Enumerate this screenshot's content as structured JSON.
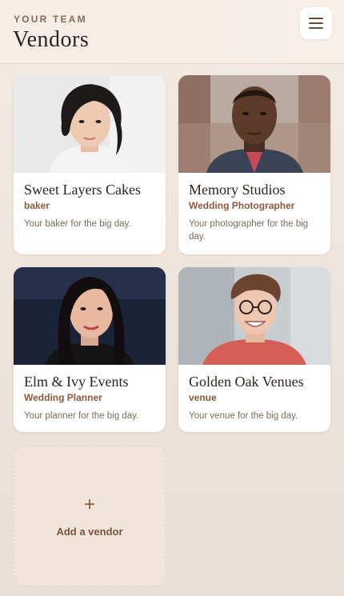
{
  "header": {
    "eyebrow": "YOUR TEAM",
    "title": "Vendors",
    "menu_icon": "hamburger-menu-icon"
  },
  "vendors": [
    {
      "name": "Sweet Layers Cakes",
      "category": "baker",
      "description": "Your baker for the big day."
    },
    {
      "name": "Memory Studios",
      "category": "Wedding Photographer",
      "description": "Your photographer for the big day."
    },
    {
      "name": "Elm & Ivy Events",
      "category": "Wedding Planner",
      "description": "Your planner for the big day."
    },
    {
      "name": "Golden Oak Venues",
      "category": "venue",
      "description": "Your venue for the big day."
    }
  ],
  "add_vendor": {
    "icon": "plus-icon",
    "symbol": "+",
    "label": "Add a vendor"
  },
  "colors": {
    "accent": "#8b5a3c",
    "background": "#efe6de",
    "card": "#ffffff"
  }
}
